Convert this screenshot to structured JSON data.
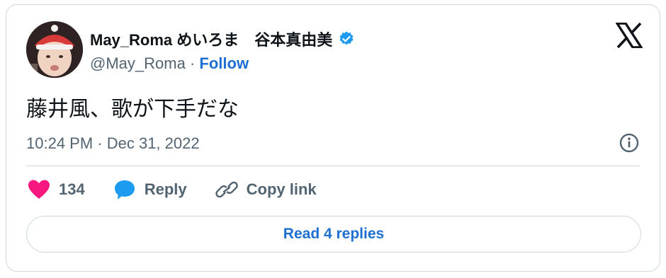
{
  "author": {
    "display_name": "May_Roma めいろま　谷本真由美",
    "handle": "@May_Roma",
    "separator": "·",
    "follow_label": "Follow"
  },
  "tweet": {
    "text": "藤井風、歌が下手だな",
    "timestamp": "10:24 PM · Dec 31, 2022"
  },
  "actions": {
    "like_count": "134",
    "reply_label": "Reply",
    "copy_link_label": "Copy link"
  },
  "read_replies_label": "Read 4 replies",
  "colors": {
    "accent": "#1d6fd1",
    "like": "#f91880",
    "verified": "#1d9bf0",
    "muted": "#536471",
    "border": "#cfd9de"
  },
  "icons": [
    "verified-badge-icon",
    "x-logo-icon",
    "info-icon",
    "heart-icon",
    "reply-icon",
    "link-icon"
  ]
}
